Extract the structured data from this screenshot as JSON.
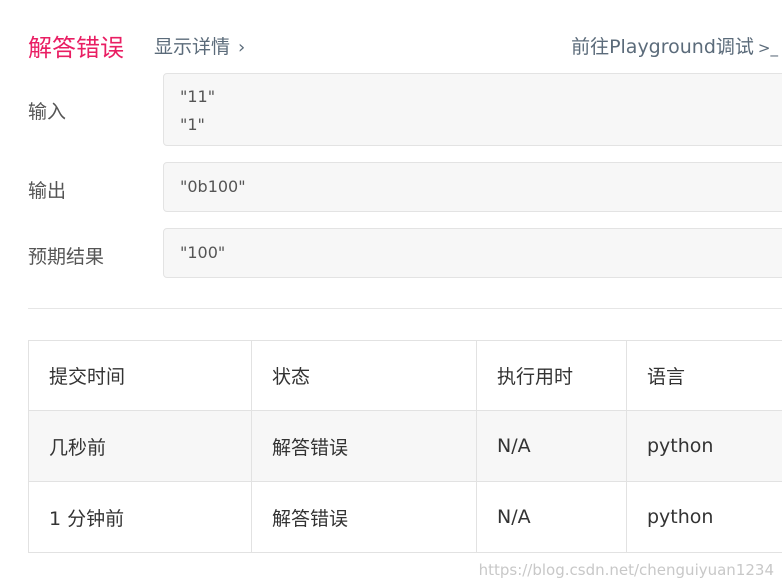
{
  "header": {
    "result": "解答错误",
    "details_link": "显示详情",
    "playground_link": "前往Playground调试"
  },
  "io": {
    "input_label": "输入",
    "input_lines": [
      "\"11\"",
      "\"1\""
    ],
    "output_label": "输出",
    "output_value": "\"0b100\"",
    "expected_label": "预期结果",
    "expected_value": "\"100\""
  },
  "table": {
    "headers": [
      "提交时间",
      "状态",
      "执行用时",
      "语言"
    ],
    "rows": [
      [
        "几秒前",
        "解答错误",
        "N/A",
        "python"
      ],
      [
        "1 分钟前",
        "解答错误",
        "N/A",
        "python"
      ]
    ]
  },
  "watermark": "https://blog.csdn.net/chenguiyuan1234",
  "colors": {
    "error_title": "#e91e63",
    "error_status": "#c62828",
    "link": "#5b6b7a"
  },
  "icons": {
    "details_chevron": "chevron-right-icon",
    "playground_terminal": "terminal-icon"
  }
}
